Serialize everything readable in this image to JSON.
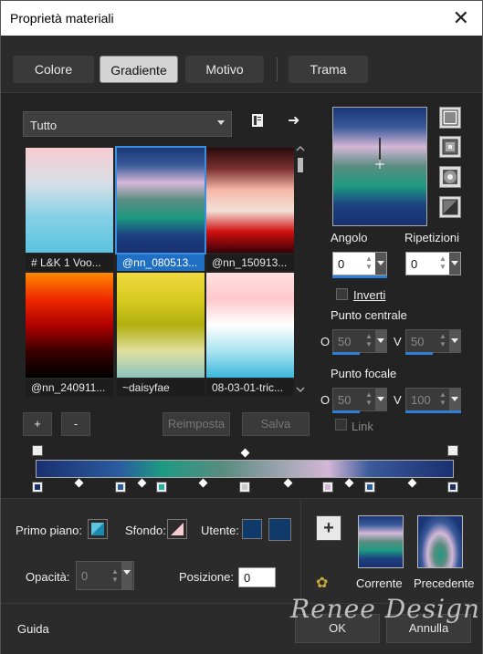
{
  "window": {
    "title": "Proprietà materiali",
    "close_glyph": "✕"
  },
  "tabs": [
    {
      "label": "Colore",
      "active": false
    },
    {
      "label": "Gradiente",
      "active": true
    },
    {
      "label": "Motivo",
      "active": false
    },
    {
      "label": "Trama",
      "active": false
    }
  ],
  "library": {
    "category": "Tutto",
    "tiles": [
      {
        "label": "# L&K 1 Voo...",
        "selected": false,
        "colors": [
          "#f8ccd2",
          "#d7dfe6",
          "#84d0e6",
          "#5cc3e0"
        ]
      },
      {
        "label": "@nn_080513...",
        "selected": true,
        "colors": [
          "#1a3676",
          "#3a5a9a",
          "#d4b7d7",
          "#5a8c80",
          "#1d9a82",
          "#1b4080",
          "#1a3070"
        ]
      },
      {
        "label": "@nn_150913...",
        "selected": false,
        "colors": [
          "#2a0c0c",
          "#7a3030",
          "#f4b6a6",
          "#f2e2d8",
          "#d01010",
          "#3a0008"
        ]
      },
      {
        "label": "@nn_240911...",
        "selected": false,
        "colors": [
          "#ff8a00",
          "#f02a00",
          "#b00000",
          "#3a0000",
          "#000000"
        ]
      },
      {
        "label": "~daisyfae",
        "selected": false,
        "colors": [
          "#f0d840",
          "#d8cc20",
          "#b4b010",
          "#e0e0a0",
          "#8ac4c0"
        ]
      },
      {
        "label": "08-03-01-tric...",
        "selected": false,
        "colors": [
          "#ffe0e0",
          "#ffc8cc",
          "#ffffff",
          "#a8e4f0",
          "#3cb8dc"
        ]
      }
    ]
  },
  "buttons": {
    "add": "+",
    "remove": "-",
    "reset": "Reimposta",
    "save": "Salva",
    "ok": "OK",
    "cancel": "Annulla",
    "help": "Guida",
    "add_swatch": "+"
  },
  "settings": {
    "angle_label": "Angolo",
    "angle_value": "0",
    "repeats_label": "Ripetizioni",
    "repeats_value": "0",
    "invert_label": "Inverti",
    "center_label": "Punto centrale",
    "center_h": "50",
    "center_v": "50",
    "focal_label": "Punto focale",
    "focal_h": "50",
    "focal_v": "100",
    "link_label": "Link",
    "h_axis": "O",
    "v_axis": "V"
  },
  "gradient_stops": {
    "colors": [
      "#1a3676",
      "#2a5ca0",
      "#26b0a0",
      "#d4b7d7",
      "#1a3070"
    ]
  },
  "colors": {
    "foreground_label": "Primo piano:",
    "background_label": "Sfondo:",
    "user_label": "Utente:",
    "user_color": "#0f3a6a",
    "opacity_label": "Opacità:",
    "opacity_value": "0",
    "position_label": "Posizione:",
    "position_value": "0",
    "current_label": "Corrente",
    "previous_label": "Precedente"
  },
  "watermark": {
    "text": "Renee Design"
  }
}
